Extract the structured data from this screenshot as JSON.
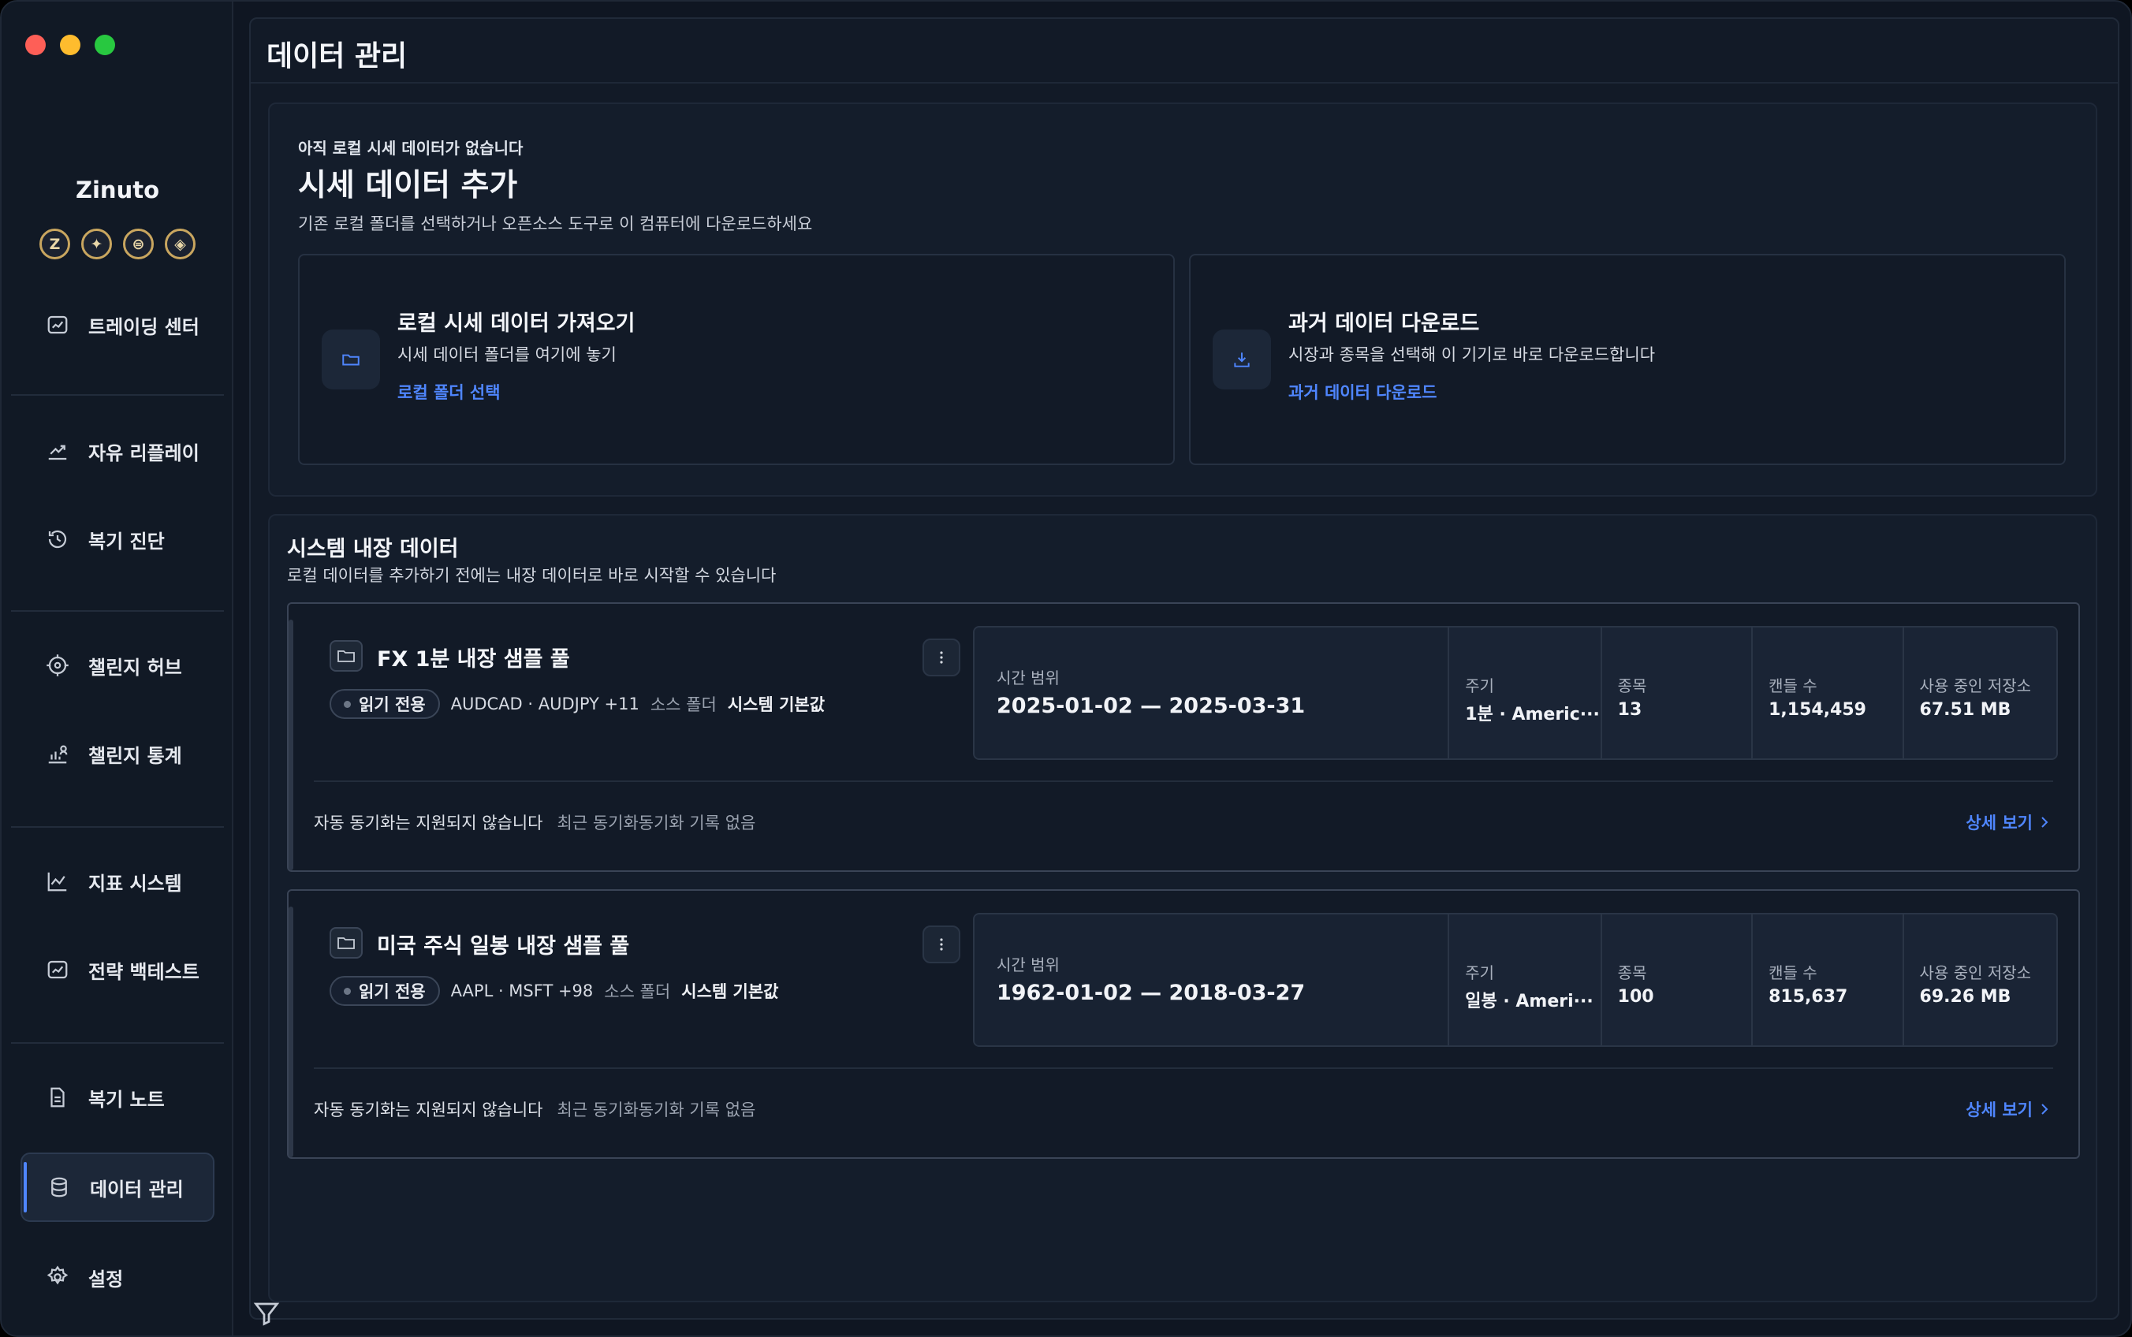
{
  "app": {
    "brand": "Zinuto",
    "brand_icons": [
      "Z",
      "✦",
      "⊜",
      "◈"
    ]
  },
  "sidebar": {
    "items": [
      {
        "label": "트레이딩 센터",
        "icon": "chart-window-icon"
      },
      {
        "label": "자유 리플레이",
        "icon": "trend-up-icon"
      },
      {
        "label": "복기 진단",
        "icon": "history-icon"
      },
      {
        "label": "챌린지 허브",
        "icon": "target-icon"
      },
      {
        "label": "챌린지 통계",
        "icon": "bar-user-icon"
      },
      {
        "label": "지표 시스템",
        "icon": "line-chart-icon"
      },
      {
        "label": "전략 백테스트",
        "icon": "chart-window-icon"
      },
      {
        "label": "복기 노트",
        "icon": "document-icon"
      },
      {
        "label": "데이터 관리",
        "icon": "database-icon",
        "active": true
      },
      {
        "label": "설정",
        "icon": "gear-icon"
      }
    ]
  },
  "page": {
    "title": "데이터 관리"
  },
  "add_data": {
    "kicker": "아직 로컬 시세 데이터가 없습니다",
    "headline": "시세 데이터 추가",
    "subtitle": "기존 로컬 폴더를 선택하거나 오픈소스 도구로 이 컴퓨터에 다운로드하세요",
    "import_card": {
      "title": "로컬 시세 데이터 가져오기",
      "desc": "시세 데이터 폴더를 여기에 놓기",
      "link": "로컬 폴더 선택"
    },
    "download_card": {
      "title": "과거 데이터 다운로드",
      "desc": "시장과 종목을 선택해 이 기기로 바로 다운로드합니다",
      "link": "과거 데이터 다운로드"
    }
  },
  "builtin": {
    "title": "시스템 내장 데이터",
    "desc": "로컬 데이터를 추가하기 전에는 내장 데이터로 바로 시작할 수 있습니다",
    "pools": [
      {
        "title": "FX 1분 내장 샘플 풀",
        "badge": "읽기 전용",
        "symbols": "AUDCAD · AUDJPY +11",
        "source_label": "소스 폴더",
        "source_value": "시스템 기본값",
        "stats": {
          "range_label": "시간 범위",
          "range_value": "2025-01-02 — 2025-03-31",
          "period_label": "주기",
          "period_value": "1분 · Americ···",
          "symbols_label": "종목",
          "symbols_value": "13",
          "candles_label": "캔들 수",
          "candles_value": "1,154,459",
          "storage_label": "사용 중인 저장소",
          "storage_value": "67.51 MB"
        },
        "sync_text": "자동 동기화는 지원되지 않습니다",
        "sync_recent": "최근 동기화동기화 기록 없음",
        "detail": "상세 보기"
      },
      {
        "title": "미국 주식 일봉 내장 샘플 풀",
        "badge": "읽기 전용",
        "symbols": "AAPL · MSFT +98",
        "source_label": "소스 폴더",
        "source_value": "시스템 기본값",
        "stats": {
          "range_label": "시간 범위",
          "range_value": "1962-01-02 — 2018-03-27",
          "period_label": "주기",
          "period_value": "일봉 · Ameri···",
          "symbols_label": "종목",
          "symbols_value": "100",
          "candles_label": "캔들 수",
          "candles_value": "815,637",
          "storage_label": "사용 중인 저장소",
          "storage_value": "69.26 MB"
        },
        "sync_text": "자동 동기화는 지원되지 않습니다",
        "sync_recent": "최근 동기화동기화 기록 없음",
        "detail": "상세 보기"
      }
    ]
  },
  "colors": {
    "accent": "#4f86ff",
    "background": "#0f1622",
    "panel": "#141d2b"
  }
}
